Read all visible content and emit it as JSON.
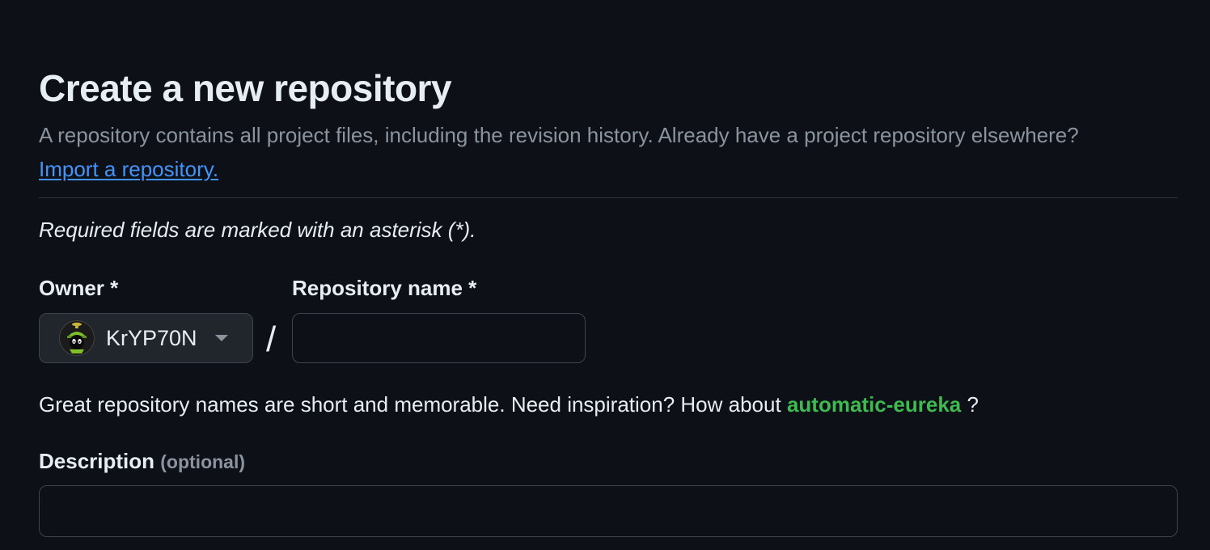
{
  "header": {
    "title": "Create a new repository",
    "subtitle_text": "A repository contains all project files, including the revision history. Already have a project repository elsewhere?",
    "import_link": "Import a repository."
  },
  "required_note": "Required fields are marked with an asterisk (*).",
  "owner": {
    "label": "Owner *",
    "value": "KrYP70N"
  },
  "separator": "/",
  "repository_name": {
    "label": "Repository name *",
    "value": "",
    "placeholder": ""
  },
  "hint": {
    "text": "Great repository names are short and memorable. Need inspiration? How about",
    "suggestion": "automatic-eureka",
    "suffix": "?"
  },
  "description": {
    "label": "Description",
    "optional": "(optional)",
    "value": "",
    "placeholder": ""
  },
  "colors": {
    "background": "#0d1117",
    "link": "#4493f8",
    "suggestion": "#3fb950",
    "muted": "#8b949e",
    "border": "#3d444d"
  },
  "icons": {
    "owner_avatar": "marvin-martian-avatar",
    "owner_dropdown": "triangle-down-icon"
  }
}
